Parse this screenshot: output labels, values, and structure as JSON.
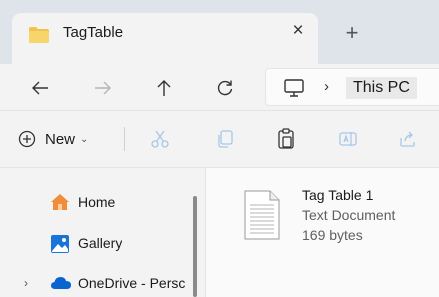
{
  "tab": {
    "title": "TagTable",
    "close_symbol": "×",
    "new_tab_symbol": "+"
  },
  "address": {
    "location": "This PC",
    "separator": "›"
  },
  "toolbar": {
    "new_label": "New",
    "new_chevron": "⌄"
  },
  "sidebar": {
    "items": [
      {
        "label": "Home",
        "icon": "home-icon"
      },
      {
        "label": "Gallery",
        "icon": "gallery-icon"
      },
      {
        "label": "OneDrive - Persc",
        "icon": "cloud-icon",
        "expand": "›"
      }
    ]
  },
  "content": {
    "files": [
      {
        "name": "Tag Table 1",
        "type": "Text Document",
        "size": "169 bytes",
        "icon": "text-document-icon"
      }
    ]
  },
  "colors": {
    "accent": "#0067c0",
    "folder": "#f2c14e",
    "titlebar": "#dfe3ea",
    "background": "#f3f3f3"
  }
}
